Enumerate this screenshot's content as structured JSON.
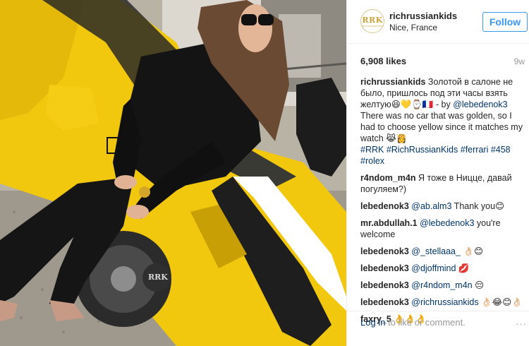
{
  "post": {
    "username": "richrussiankids",
    "location": "Nice, France",
    "follow_label": "Follow",
    "avatar_text": "RRK",
    "avatar_sub": "RICH RUSSIAN KIDS",
    "likes": "6,908 likes",
    "age": "9w"
  },
  "caption": {
    "author": "richrussiankids",
    "line1": "Золотой в салоне не было, пришлось под эти часы взять желтую",
    "emoji1": "😆💛⌚🇫🇷",
    "by": " - by ",
    "mention": "@lebedenok3",
    "line2": "There was no car that was golden, so I had to choose yellow since it matches my watch",
    "emoji2": "😹👸",
    "tags": [
      "#RRK",
      "#RichRussianKids",
      "#ferrari",
      "#458",
      "#rolex"
    ]
  },
  "comments": [
    {
      "author": "r4ndom_m4n",
      "text": "Я тоже в Ницце, давай погуляем?)"
    },
    {
      "author": "lebedenok3",
      "mention": "@ab.alm3",
      "text": " Thank you😊"
    },
    {
      "author": "mr.abdullah.1",
      "mention": "@lebedenok3",
      "text": " you're welcome"
    },
    {
      "author": "lebedenok3",
      "mention": "@_stellaaa_",
      "text": "👌🏻😊"
    },
    {
      "author": "lebedenok3",
      "mention": "@djoffmind",
      "text": " 💋"
    },
    {
      "author": "lebedenok3",
      "mention": "@r4ndom_m4n",
      "text": " 😔"
    },
    {
      "author": "lebedenok3",
      "mention": "@richrussiankids",
      "text": " 👌🏻😂😊👌🏻"
    },
    {
      "author": "faxry_5",
      "text": "👌👌👌"
    }
  ],
  "footer": {
    "login_link": "Log in",
    "login_text": " to like or comment.",
    "more": "···"
  },
  "photo": {
    "description_colors": {
      "car": "#f2c80f",
      "jacket": "#1a1a1a",
      "gravel": "#9c958a"
    },
    "watermark": "RRK"
  }
}
